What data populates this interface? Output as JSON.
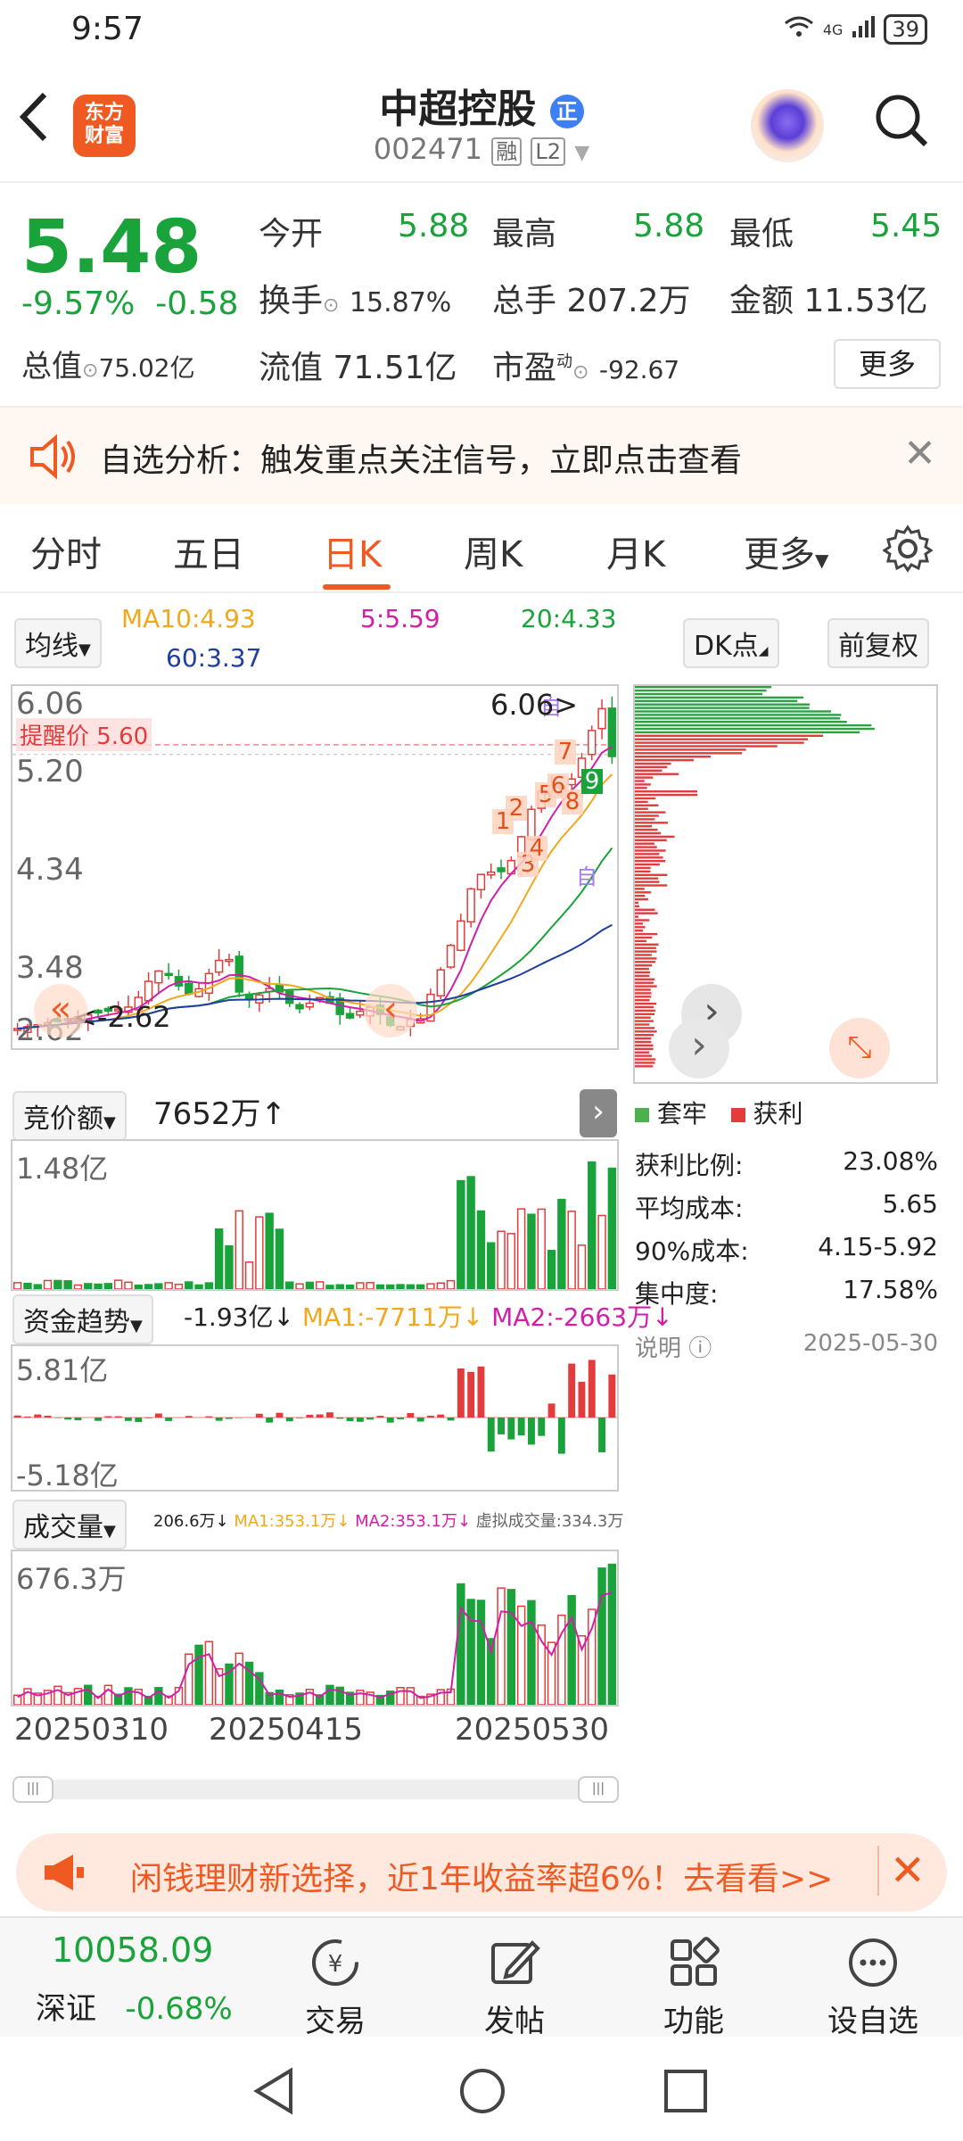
{
  "status_bar": {
    "time": "9:57",
    "network": "4G",
    "battery": "39"
  },
  "header": {
    "logo_line1": "东方",
    "logo_line2": "财富",
    "stock_name": "中超控股",
    "name_badge": "正",
    "stock_code": "002471",
    "tag_margin": "融",
    "tag_level": "L2"
  },
  "quote": {
    "price": "5.48",
    "change_pct": "-9.57%",
    "change_amt": "-0.58",
    "open_label": "今开",
    "open": "5.88",
    "high_label": "最高",
    "high": "5.88",
    "low_label": "最低",
    "low": "5.45",
    "turnover_label": "换手",
    "turnover": "15.87%",
    "volume_label": "总手",
    "volume": "207.2万",
    "amount_label": "金额",
    "amount": "11.53亿",
    "mktcap_label": "总值",
    "mktcap": "75.02亿",
    "float_label": "流值",
    "float_cap": "71.51亿",
    "pe_label": "市盈",
    "pe_sup": "动",
    "pe": "-92.67",
    "more_label": "更多"
  },
  "banner": {
    "text": "自选分析：触发重点关注信号，立即点击查看"
  },
  "tabs": [
    "分时",
    "五日",
    "日K",
    "周K",
    "月K",
    "更多"
  ],
  "active_tab": "日K",
  "kline": {
    "ma_selector": "均线",
    "ma10": "MA10:4.93",
    "ma5": "5:5.59",
    "ma20": "20:4.33",
    "ma60": "60:3.37",
    "dk_label": "DK点",
    "adjust_label": "前复权",
    "y_ticks": [
      "6.06",
      "5.20",
      "4.34",
      "3.48",
      "2.62"
    ],
    "high_marker": "6.06",
    "low_marker": "2.62",
    "alert_label": "提醒价 5.60",
    "signal_labels": [
      "1",
      "2",
      "3",
      "4",
      "5",
      "6",
      "7",
      "8",
      "9"
    ],
    "self_label": "自",
    "colors": {
      "up": "#e23c3c",
      "down": "#19a33a",
      "ma5": "#d11fa8",
      "ma10": "#f2a81d",
      "ma20": "#19a33a",
      "ma60": "#1f3f9e"
    }
  },
  "chip": {
    "legend_trapped": "套牢",
    "legend_profit": "获利",
    "rows": [
      {
        "label": "获利比例:",
        "value": "23.08%"
      },
      {
        "label": "平均成本:",
        "value": "5.65"
      },
      {
        "label": "90%成本:",
        "value": "4.15-5.92"
      },
      {
        "label": "集中度:",
        "value": "17.58%"
      }
    ],
    "note_label": "说明",
    "date": "2025-05-30"
  },
  "auction": {
    "selector": "竞价额",
    "value": "7652万",
    "top": "1.48亿"
  },
  "fund": {
    "selector": "资金趋势",
    "value": "-1.93亿",
    "ma1": "MA1:-7711万",
    "ma2": "MA2:-2663万",
    "top": "5.81亿",
    "bottom": "-5.18亿"
  },
  "vol": {
    "selector": "成交量",
    "value": "206.6万",
    "ma1": "MA1:353.1万",
    "ma2": "MA2:353.1万",
    "virtual": "虚拟成交量:334.3万",
    "top": "676.3万"
  },
  "dates": [
    "20250310",
    "20250415",
    "20250530"
  ],
  "promo": {
    "text": "闲钱理财新选择，近1年收益率超6%！去看看>>"
  },
  "footer": {
    "index_value": "10058.09",
    "index_name": "深证",
    "index_change": "-0.68%",
    "items": [
      "交易",
      "发帖",
      "功能",
      "设自选"
    ]
  }
}
